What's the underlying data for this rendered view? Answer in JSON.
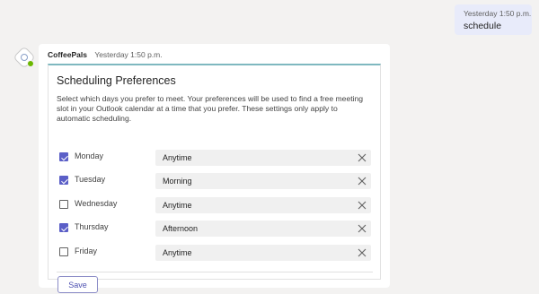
{
  "sent_message": {
    "timestamp": "Yesterday 1:50 p.m.",
    "text": "schedule"
  },
  "bot_message": {
    "sender": "CoffeePals",
    "timestamp": "Yesterday 1:50 p.m.",
    "card": {
      "title": "Scheduling Preferences",
      "description": "Select which days you prefer to meet. Your preferences will be used to find a free meeting slot in your Outlook calendar at a time that you prefer. These settings only apply to automatic scheduling.",
      "days": [
        {
          "label": "Monday",
          "checked": true,
          "time": "Anytime"
        },
        {
          "label": "Tuesday",
          "checked": true,
          "time": "Morning"
        },
        {
          "label": "Wednesday",
          "checked": false,
          "time": "Anytime"
        },
        {
          "label": "Thursday",
          "checked": true,
          "time": "Afternoon"
        },
        {
          "label": "Friday",
          "checked": false,
          "time": "Anytime"
        }
      ],
      "save_label": "Save"
    }
  },
  "colors": {
    "accent": "#5b5fc7",
    "presence": "#6bb700",
    "card_top_border": "#7fb8c0"
  },
  "icons": {
    "clear": "close-icon",
    "avatar": "coffeepals-logo-icon"
  }
}
